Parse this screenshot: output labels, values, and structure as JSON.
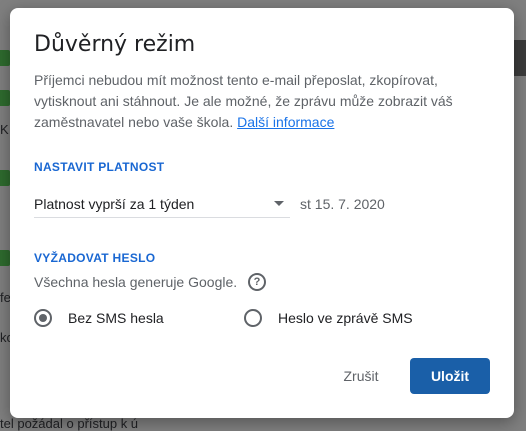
{
  "background": {
    "text_fragments": [
      "K",
      "fe",
      "ko",
      "tel požádal o přístup k ú"
    ]
  },
  "dialog": {
    "title": "Důvěrný režim",
    "description": "Příjemci nebudou mít možnost tento e-mail přeposlat, zkopírovat, vytisknout ani stáhnout. Je ale možné, že zprávu může zobrazit váš zaměstnavatel nebo vaše škola.",
    "learn_more_link": "Další informace",
    "expiry": {
      "section_label": "NASTAVIT PLATNOST",
      "selected": "Platnost vyprší za 1 týden",
      "date": "st 15. 7. 2020"
    },
    "password": {
      "section_label": "VYŽADOVAT HESLO",
      "hint": "Všechna hesla generuje Google.",
      "options": [
        {
          "label": "Bez SMS hesla",
          "checked": true
        },
        {
          "label": "Heslo ve zprávě SMS",
          "checked": false
        }
      ]
    },
    "buttons": {
      "cancel": "Zrušit",
      "save": "Uložit"
    }
  },
  "colors": {
    "accent": "#1a73e8",
    "primary_button": "#1a5fa8",
    "section_label": "#1967d2",
    "scrim": "#7f7f7f"
  },
  "icons": {
    "help": "question-circle-icon",
    "dropdown": "caret-down-icon"
  }
}
